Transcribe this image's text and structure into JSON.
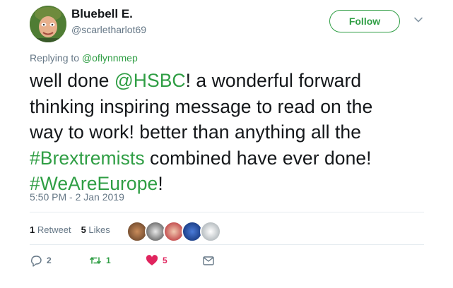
{
  "user": {
    "display_name": "Bluebell E.",
    "screen_name": "@scarletharlot69"
  },
  "follow_label": "Follow",
  "replying": {
    "prefix": "Replying to",
    "handle": "@oflynnmep"
  },
  "tweet": {
    "line1_a": "well done ",
    "mention": "@HSBC",
    "line1_b": "! a wonderful forward",
    "line2": "thinking inspiring message to read on the",
    "line3": "way to work! better than anything all the",
    "hashtag1": "#Brextremists",
    "line4_b": " combined have ever done!",
    "hashtag2": "#WeAreEurope",
    "line5_b": "!"
  },
  "timestamp": "5:50 PM - 2 Jan 2019",
  "stats": {
    "retweets_count": "1",
    "retweets_label": "Retweet",
    "likes_count": "5",
    "likes_label": "Likes"
  },
  "actions": {
    "reply_count": "2",
    "retweet_count": "1",
    "like_count": "5"
  },
  "colors": {
    "accent": "#2f9e44",
    "like": "#e0245e",
    "muted": "#657786"
  },
  "icons": [
    "chevron-down-icon",
    "reply-icon",
    "retweet-icon",
    "heart-icon",
    "message-icon"
  ]
}
